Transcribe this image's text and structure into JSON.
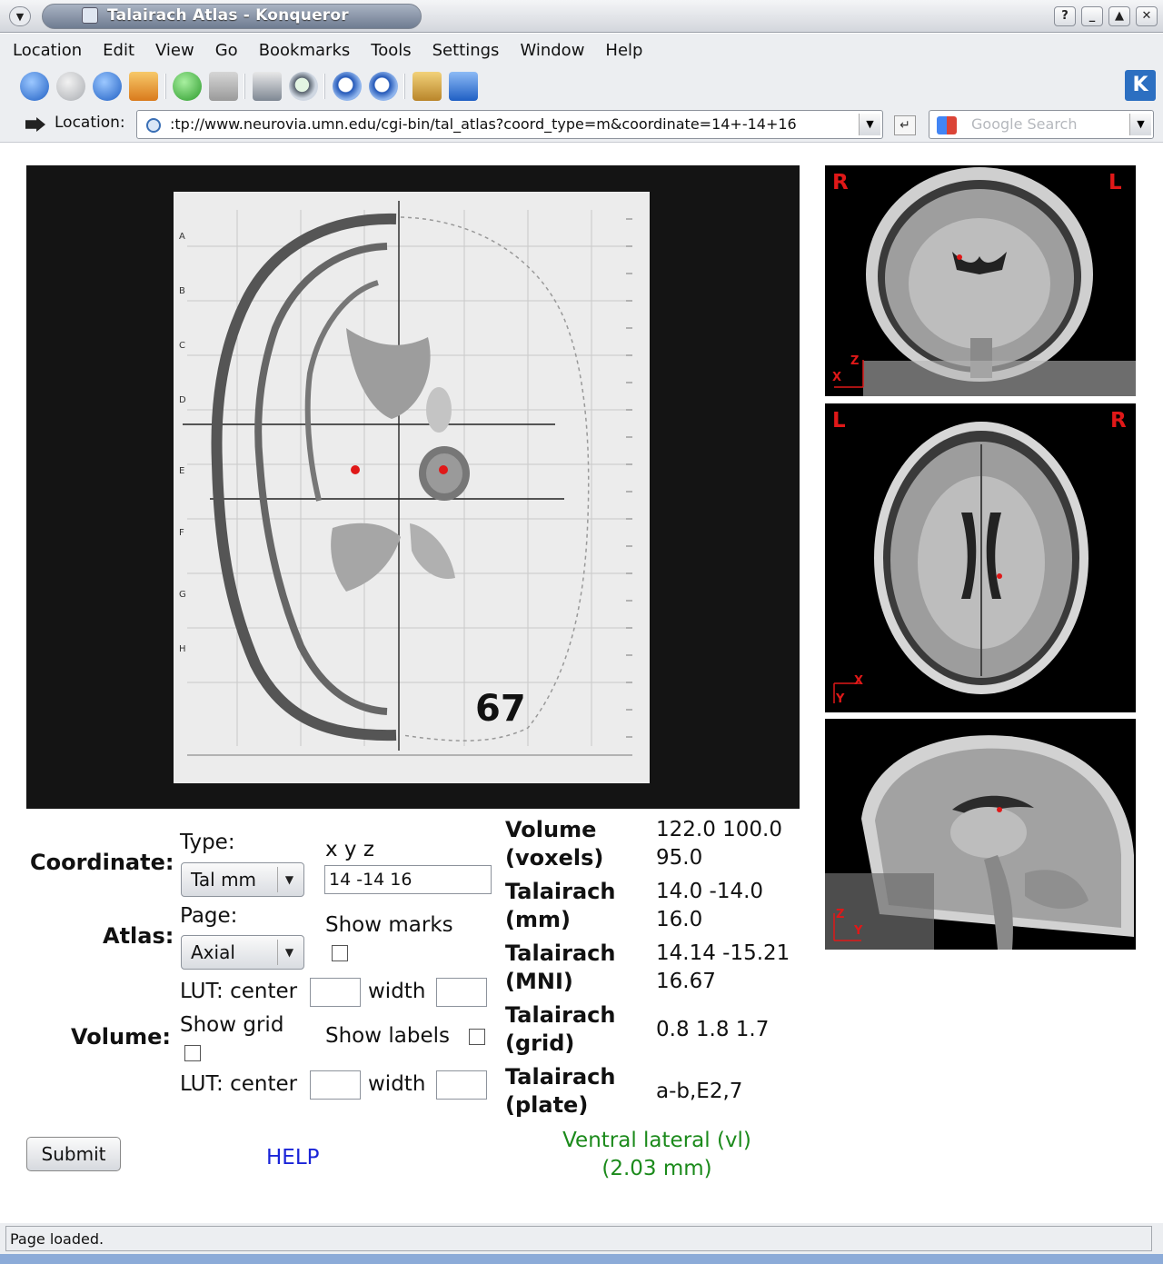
{
  "window": {
    "title": "Talairach Atlas - Konqueror",
    "buttons": [
      "?",
      "_",
      "▲",
      "✕"
    ]
  },
  "menubar": {
    "items": [
      "Location",
      "Edit",
      "View",
      "Go",
      "Bookmarks",
      "Tools",
      "Settings",
      "Window",
      "Help"
    ]
  },
  "toolbar": {
    "icons": [
      "back-icon",
      "forward-icon",
      "up-icon",
      "home-icon",
      "reload-icon",
      "stop-icon",
      "print-icon",
      "find-icon",
      "zoom-in-icon",
      "zoom-out-icon",
      "security-icon",
      "download-icon"
    ]
  },
  "location_bar": {
    "label": "Location:",
    "url": ":tp://www.neurovia.umn.edu/cgi-bin/tal_atlas?coord_type=m&coordinate=14+-14+16",
    "search_placeholder": "Google Search"
  },
  "atlas": {
    "plate_number": "67"
  },
  "mri": {
    "coronal": {
      "left": "R",
      "right": "L",
      "axis_h": "X",
      "axis_v": "Z"
    },
    "axial": {
      "left": "L",
      "right": "R",
      "axis_h": "X",
      "axis_v": "Y"
    },
    "sagittal": {
      "axis_h": "Y",
      "axis_v": "Z"
    },
    "marker_color": "#e01818"
  },
  "form": {
    "coordinate_label": "Coordinate:",
    "type_label": "Type:",
    "type_value": "Tal mm",
    "xyz_label": "x y z",
    "xyz_value": "14 -14 16",
    "atlas_label": "Atlas:",
    "page_label": "Page:",
    "page_value": "Axial",
    "show_marks_label": "Show marks",
    "atlas_lut_center_label": "LUT: center",
    "atlas_lut_width_label": "width",
    "volume_label": "Volume:",
    "show_grid_label": "Show grid",
    "show_labels_label": "Show labels",
    "volume_lut_center_label": "LUT: center",
    "volume_lut_width_label": "width",
    "submit_label": "Submit",
    "help_label": "HELP"
  },
  "info": {
    "volume_key_1": "Volume",
    "volume_key_2": "(voxels)",
    "volume_val": "122.0 100.0 95.0",
    "tal_mm_key_1": "Talairach",
    "tal_mm_key_2": "(mm)",
    "tal_mm_val": "14.0 -14.0 16.0",
    "tal_mni_key_1": "Talairach",
    "tal_mni_key_2": "(MNI)",
    "tal_mni_val": "14.14 -15.21 16.67",
    "tal_grid_key_1": "Talairach",
    "tal_grid_key_2": "(grid)",
    "tal_grid_val": "0.8 1.8 1.7",
    "tal_plate_key_1": "Talairach",
    "tal_plate_key_2": "(plate)",
    "tal_plate_val": "a-b,E2,7",
    "structure_line_1": "Ventral lateral (vl)",
    "structure_line_2": "(2.03 mm)"
  },
  "status": {
    "text": "Page loaded."
  }
}
